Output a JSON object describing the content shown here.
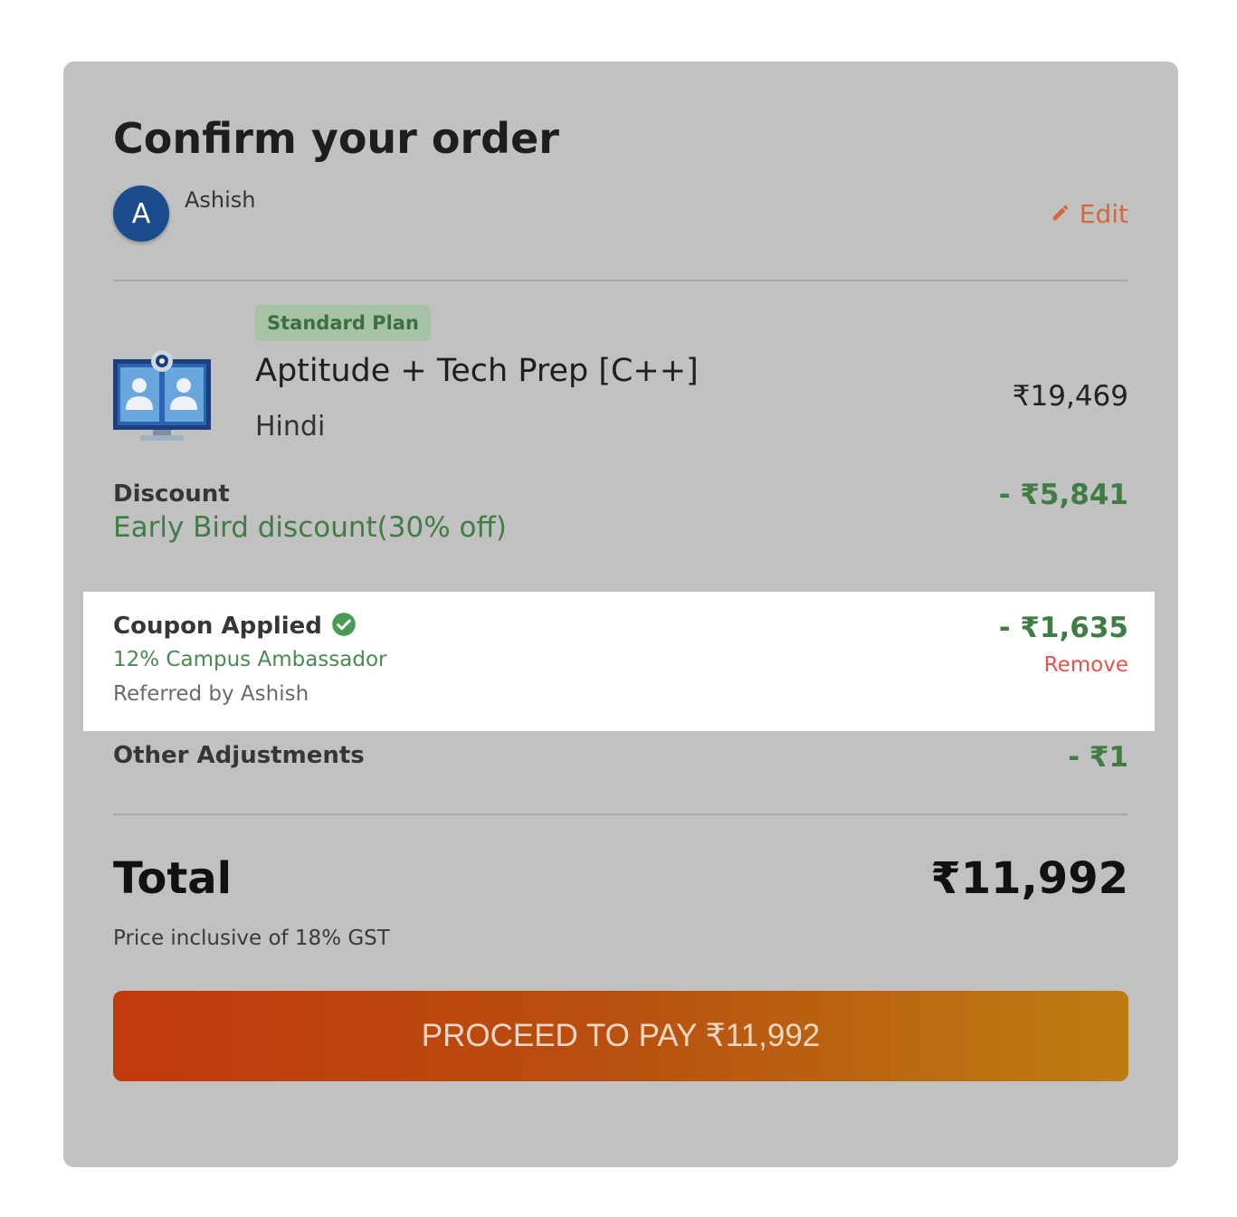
{
  "page": {
    "title": "Confirm your order"
  },
  "user": {
    "avatar_letter": "A",
    "name": "Ashish",
    "edit_label": "Edit"
  },
  "course": {
    "plan_badge": "Standard Plan",
    "name": "Aptitude + Tech Prep [C++]",
    "language": "Hindi",
    "price": "₹19,469"
  },
  "discount": {
    "label": "Discount",
    "description": "Early Bird discount(30% off)",
    "amount": "- ₹5,841"
  },
  "coupon": {
    "label": "Coupon Applied",
    "code": "12% Campus Ambassador",
    "referred_by": "Referred by Ashish",
    "amount": "- ₹1,635",
    "remove_label": "Remove"
  },
  "adjustments": {
    "label": "Other Adjustments",
    "amount": "- ₹1"
  },
  "total": {
    "label": "Total",
    "value": "₹11,992",
    "note": "Price inclusive of 18% GST"
  },
  "cta": {
    "label": "PROCEED TO PAY ₹11,992"
  },
  "icons": {
    "edit": "pencil-icon",
    "coupon_status": "check-circle-icon",
    "course": "video-call-monitor-icon"
  },
  "colors": {
    "card_bg": "#c1c1c1",
    "accent_orange": "#d5683a",
    "success_green": "#3f7d44",
    "remove_red": "#e0564b",
    "avatar_blue": "#1a4c8c",
    "cta_gradient_start": "#c2390d",
    "cta_gradient_end": "#bd7d12"
  }
}
